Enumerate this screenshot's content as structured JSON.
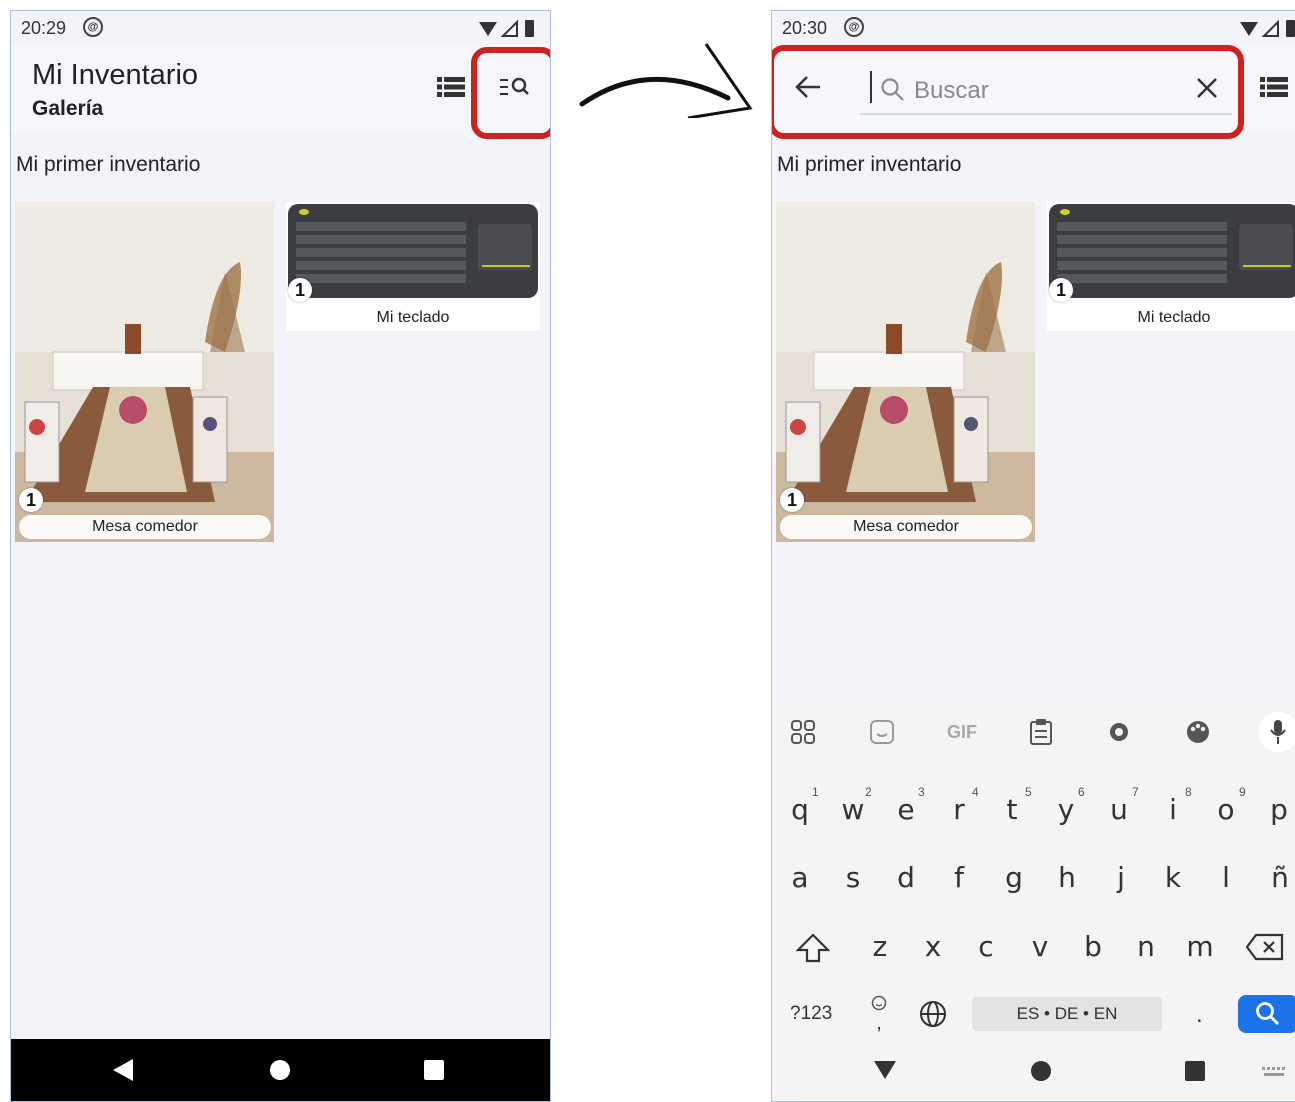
{
  "left_screen": {
    "status": {
      "time": "20:29"
    },
    "appbar": {
      "title": "Mi Inventario",
      "subtitle": "Galería"
    },
    "section_title": "Mi primer inventario",
    "items": [
      {
        "caption": "Mesa comedor",
        "count": "1"
      },
      {
        "caption": "Mi teclado",
        "count": "1"
      }
    ]
  },
  "right_screen": {
    "status": {
      "time": "20:30"
    },
    "search": {
      "placeholder": "Buscar"
    },
    "section_title": "Mi primer inventario",
    "items": [
      {
        "caption": "Mesa comedor",
        "count": "1"
      },
      {
        "caption": "Mi teclado",
        "count": "1"
      }
    ],
    "keyboard": {
      "toolbar": [
        "apps-icon",
        "sticker-icon",
        "GIF",
        "clipboard-icon",
        "settings-icon",
        "palette-icon",
        "mic-icon"
      ],
      "row1": [
        "q",
        "w",
        "e",
        "r",
        "t",
        "y",
        "u",
        "i",
        "o",
        "p"
      ],
      "row1_hints": [
        "1",
        "2",
        "3",
        "4",
        "5",
        "6",
        "7",
        "8",
        "9"
      ],
      "row2": [
        "a",
        "s",
        "d",
        "f",
        "g",
        "h",
        "j",
        "k",
        "l",
        "ñ"
      ],
      "row3": [
        "z",
        "x",
        "c",
        "v",
        "b",
        "n",
        "m"
      ],
      "symbols_label": "?123",
      "space_label": "ES • DE • EN",
      "period": ".",
      "comma": ","
    }
  },
  "colors": {
    "highlight": "#cc2222",
    "accent": "#1a73e8"
  }
}
